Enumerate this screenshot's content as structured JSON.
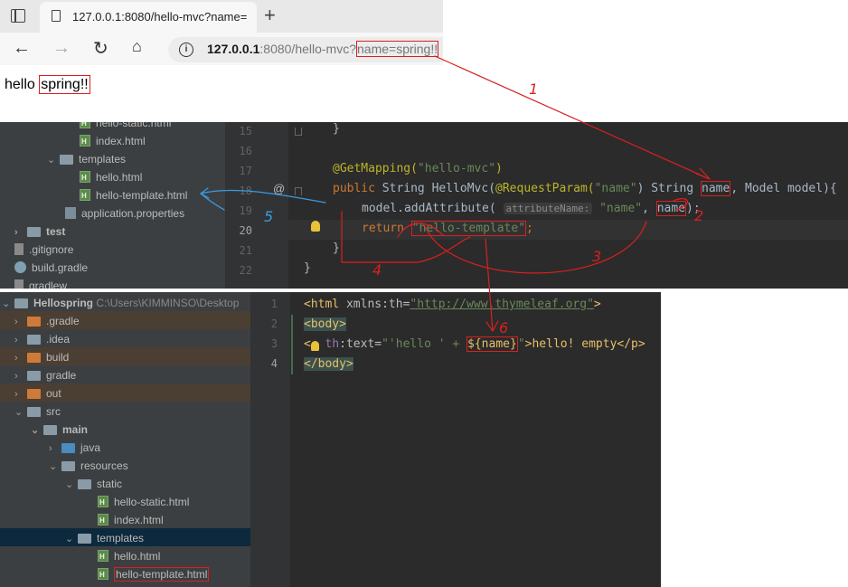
{
  "browser": {
    "tab_title": "127.0.0.1:8080/hello-mvc?name=",
    "new_tab_symbol": "+",
    "url_host": "127.0.0.1",
    "url_rest": ":8080/hello-mvc?",
    "url_query": "name=spring!!",
    "page_prefix": "hello ",
    "page_value": "spring!!"
  },
  "ide_top": {
    "tree": [
      {
        "label": "hello-static.html",
        "icon": "html-file-icon"
      },
      {
        "label": "index.html",
        "icon": "html-file-icon"
      },
      {
        "label": "templates",
        "icon": "folder-icon"
      },
      {
        "label": "hello.html",
        "icon": "html-file-icon"
      },
      {
        "label": "hello-template.html",
        "icon": "html-file-icon"
      },
      {
        "label": "application.properties",
        "icon": "properties-file-icon"
      },
      {
        "label": "test",
        "icon": "folder-icon"
      },
      {
        "label": ".gitignore",
        "icon": "file-icon"
      },
      {
        "label": "build.gradle",
        "icon": "gradle-icon"
      },
      {
        "label": "gradlew",
        "icon": "file-icon"
      }
    ],
    "line_numbers": [
      "15",
      "16",
      "17",
      "18",
      "19",
      "20",
      "21",
      "22"
    ],
    "gutter_at": "@",
    "code": {
      "l15": "}",
      "l17_ann": "@GetMapping(",
      "l17_str": "\"hello-mvc\"",
      "l17_end": ")",
      "l18_kw": "public",
      "l18_a": " String HelloMvc(",
      "l18_ann": "@RequestParam(",
      "l18_str": "\"name\"",
      "l18_b": ") String ",
      "l18_name": "name",
      "l18_c": ", Model model){",
      "l19_a": "model.addAttribute(",
      "l19_hint": "attributeName:",
      "l19_str": "\"name\"",
      "l19_b": ", ",
      "l19_name": "name",
      "l19_c": ");",
      "l20_kw": "return",
      "l20_str": "\"hello-template\"",
      "l20_end": ";",
      "l21": "}",
      "l22": "}"
    }
  },
  "ide_bottom": {
    "project_name": "Hellospring",
    "project_path": "C:\\Users\\KIMMINSO\\Desktop",
    "tree": [
      {
        "label": ".gradle",
        "icon": "folder-icon"
      },
      {
        "label": ".idea",
        "icon": "folder-icon"
      },
      {
        "label": "build",
        "icon": "folder-icon"
      },
      {
        "label": "gradle",
        "icon": "folder-icon"
      },
      {
        "label": "out",
        "icon": "folder-icon"
      },
      {
        "label": "src",
        "icon": "folder-icon"
      },
      {
        "label": "main",
        "icon": "folder-icon"
      },
      {
        "label": "java",
        "icon": "folder-icon"
      },
      {
        "label": "resources",
        "icon": "folder-icon"
      },
      {
        "label": "static",
        "icon": "folder-icon"
      },
      {
        "label": "hello-static.html",
        "icon": "html-file-icon"
      },
      {
        "label": "index.html",
        "icon": "html-file-icon"
      },
      {
        "label": "templates",
        "icon": "folder-icon"
      },
      {
        "label": "hello.html",
        "icon": "html-file-icon"
      },
      {
        "label": "hello-template.html",
        "icon": "html-file-icon"
      }
    ],
    "line_numbers": [
      "1",
      "2",
      "3",
      "4"
    ],
    "code": {
      "l1_open": "<html ",
      "l1_attr": "xmlns:th=",
      "l1_url": "\"http://www.thymeleaf.org\"",
      "l1_close": ">",
      "l2": "<body>",
      "l3_open": "<",
      "l3_ns": "th",
      "l3_attr": ":text=",
      "l3_str": "\"'hello ' + ",
      "l3_expr": "${name}",
      "l3_strend": "\"",
      "l3_rest": ">hello! empty</p>",
      "l4": "</body>"
    }
  },
  "annotations": {
    "n1": "1",
    "n2": "2",
    "n3": "3",
    "n4": "4",
    "n5": "5",
    "n6": "6",
    "red": "#d92020",
    "blue": "#3a9be0"
  }
}
